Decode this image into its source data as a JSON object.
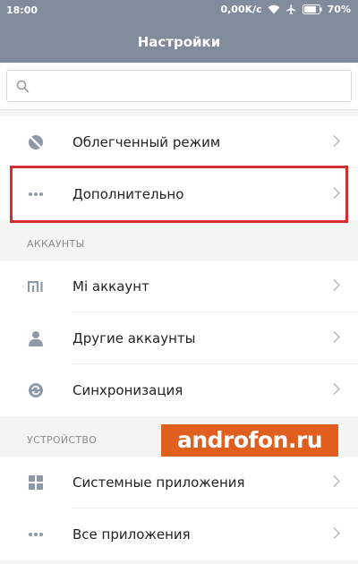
{
  "status_bar": {
    "time": "18:00",
    "network_speed": "0,00K/c",
    "battery_percent": "70%",
    "icons": [
      "wifi-icon",
      "airplane-icon",
      "battery-icon"
    ]
  },
  "app_bar": {
    "title": "Настройки"
  },
  "search": {
    "placeholder": "",
    "value": ""
  },
  "groups": {
    "top": {
      "items": [
        {
          "label": "Облегченный режим",
          "icon": "lite-mode-icon"
        },
        {
          "label": "Дополнительно",
          "icon": "more-dots-icon"
        }
      ]
    },
    "accounts": {
      "header": "АККАУНТЫ",
      "items": [
        {
          "label": "Mi аккаунт",
          "icon": "mi-logo-icon"
        },
        {
          "label": "Другие аккаунты",
          "icon": "person-icon"
        },
        {
          "label": "Синхронизация",
          "icon": "sync-icon"
        }
      ]
    },
    "device": {
      "header": "УСТРОЙСТВО",
      "items": [
        {
          "label": "Системные приложения",
          "icon": "grid-icon"
        },
        {
          "label": "Все приложения",
          "icon": "more-dots-icon"
        }
      ]
    }
  },
  "watermark": {
    "text": "androfon.ru"
  },
  "colors": {
    "header_bg": "#808b9b",
    "highlight_border": "#d32f2f",
    "watermark_bg": "#e05f1f",
    "icon_gray": "#8e99a8"
  }
}
